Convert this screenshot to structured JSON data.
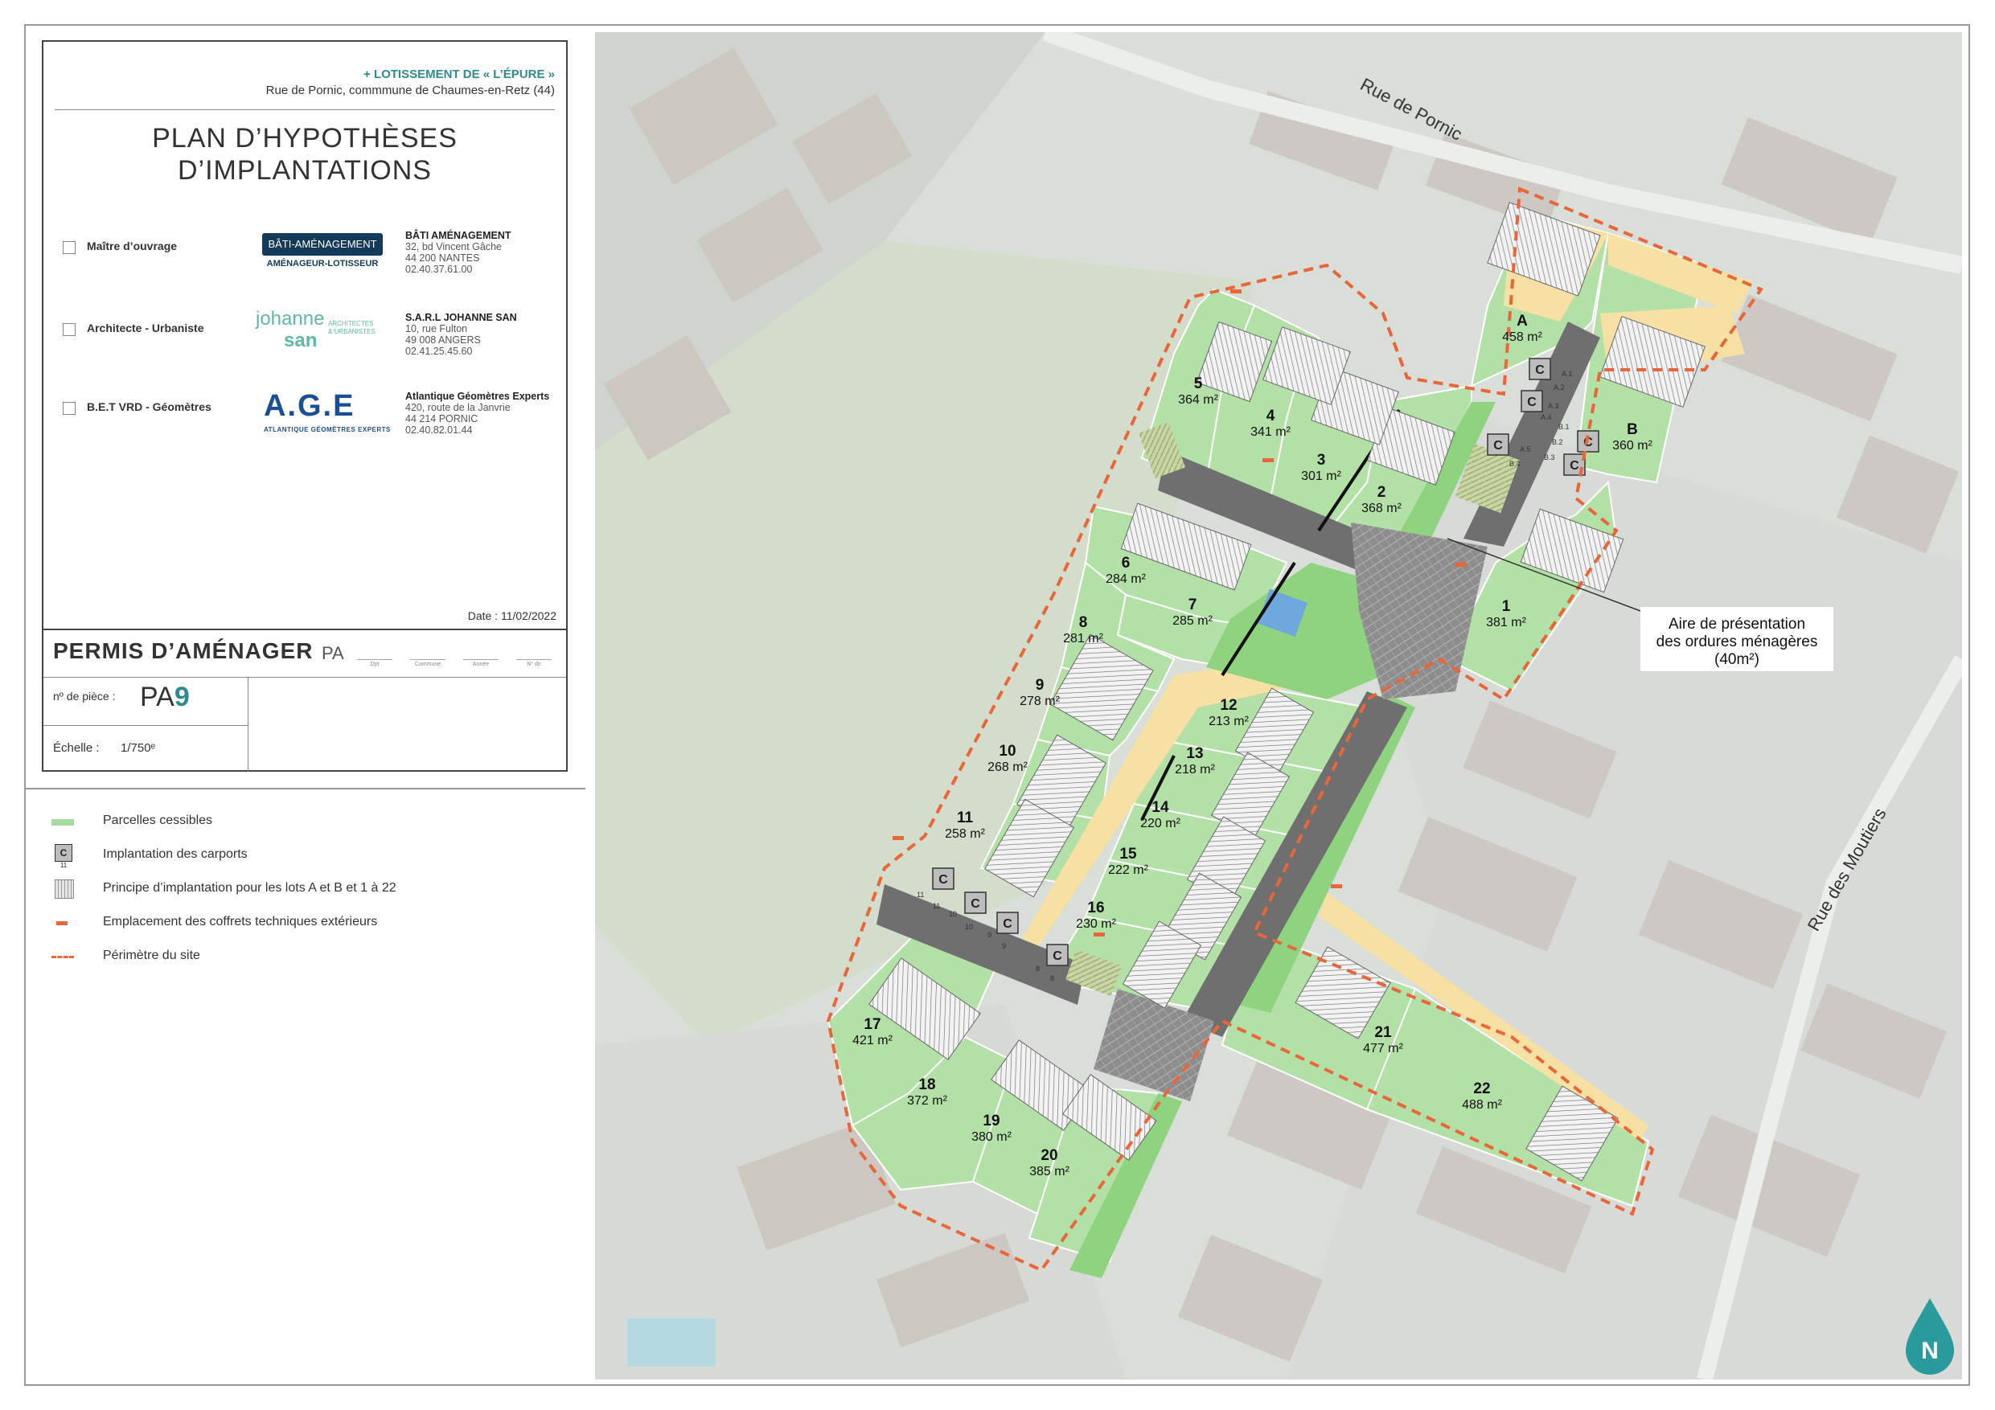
{
  "cartouche": {
    "project_name": "+ LOTISSEMENT DE « L’ÉPURE »",
    "project_address": "Rue de Pornic, commmune de Chaumes-en-Retz (44)",
    "title_line1": "PLAN D’HYPOTHÈSES",
    "title_line2": "D’IMPLANTATIONS",
    "actors": [
      {
        "role": "Maître d’ouvrage",
        "logo_text": "BÂTI-AMÉNAGEMENT",
        "logo_sub": "AMÉNAGEUR-LOTISSEUR",
        "name": "BÂTI AMÉNAGEMENT",
        "addr1": "32, bd Vincent Gâche",
        "addr2": "44 200 NANTES",
        "phone": "02.40.37.61.00"
      },
      {
        "role": "Architecte - Urbaniste",
        "logo_text": "johanne",
        "logo_text2": "san",
        "logo_sub": "ARCHITECTES & URBANISTES",
        "name": "S.A.R.L JOHANNE SAN",
        "addr1": "10, rue Fulton",
        "addr2": "49 008 ANGERS",
        "phone": "02.41.25.45.60"
      },
      {
        "role": "B.E.T VRD - Géomètres",
        "logo_text": "A.G.E",
        "logo_sub": "ATLANTIQUE GÉOMÈTRES EXPERTS",
        "name": "Atlantique Géomètres Experts",
        "addr1": "420, route de la Janvrie",
        "addr2": "44 214 PORNIC",
        "phone": "02.40.82.01.44"
      }
    ],
    "date": "Date : 11/02/2022",
    "permis": "PERMIS D’AMÉNAGER",
    "permis_pa": "PA",
    "codes": [
      "Dpt",
      "Commune",
      "Année",
      "N° dir"
    ],
    "piece_label": "nº de pièce :",
    "piece_prefix": "PA",
    "piece_number": "9",
    "echelle_label": "Échelle :",
    "echelle_value": "1/750ᵉ"
  },
  "legend": [
    {
      "label": "Parcelles cessibles",
      "symbol": "green-bar",
      "color": "#a9dba0"
    },
    {
      "label": "Implantation des carports",
      "symbol": "carport-box",
      "color": "#bdbdbd",
      "box_letter": "C",
      "box_number": "11"
    },
    {
      "label": "Principe d’implantation pour les lots A et B et 1 à 22",
      "symbol": "hatch-box",
      "color": "#cccccc"
    },
    {
      "label": "Emplacement des coffrets techniques extérieurs",
      "symbol": "orange-dash",
      "color": "#e8663a"
    },
    {
      "label": "Périmètre du site",
      "symbol": "dashed-line",
      "color": "#e8663a"
    }
  ],
  "map": {
    "colors": {
      "lot": "#b3e0a6",
      "road": "#6f6f6f",
      "path": "#f7e0a4",
      "green": "#8fd27f",
      "perimeter": "#e8663a",
      "north": "#2a9a9c"
    },
    "streets": [
      "Rue de Pornic",
      "Rue des Moutiers"
    ],
    "annotation": [
      "Aire de présentation",
      "des ordures ménagères",
      "(40m²)"
    ],
    "north_label": "N",
    "carport_letter": "C",
    "carport_labels": [
      "A.1",
      "A.2",
      "A.3",
      "A.4",
      "A.5",
      "B.1",
      "B.2",
      "B.3",
      "B.4",
      "11",
      "11",
      "10",
      "10",
      "9",
      "9",
      "8",
      "8"
    ],
    "lots": [
      {
        "id": "A",
        "area": "458 m²"
      },
      {
        "id": "B",
        "area": "360 m²"
      },
      {
        "id": "1",
        "area": "381 m²"
      },
      {
        "id": "2",
        "area": "368 m²"
      },
      {
        "id": "3",
        "area": "301 m²"
      },
      {
        "id": "4",
        "area": "341 m²"
      },
      {
        "id": "5",
        "area": "364 m²"
      },
      {
        "id": "6",
        "area": "284 m²"
      },
      {
        "id": "7",
        "area": "285 m²"
      },
      {
        "id": "8",
        "area": "281 m²"
      },
      {
        "id": "9",
        "area": "278 m²"
      },
      {
        "id": "10",
        "area": "268 m²"
      },
      {
        "id": "11",
        "area": "258 m²"
      },
      {
        "id": "12",
        "area": "213 m²"
      },
      {
        "id": "13",
        "area": "218 m²"
      },
      {
        "id": "14",
        "area": "220 m²"
      },
      {
        "id": "15",
        "area": "222 m²"
      },
      {
        "id": "16",
        "area": "230 m²"
      },
      {
        "id": "17",
        "area": "421 m²"
      },
      {
        "id": "18",
        "area": "372 m²"
      },
      {
        "id": "19",
        "area": "380 m²"
      },
      {
        "id": "20",
        "area": "385 m²"
      },
      {
        "id": "21",
        "area": "477 m²"
      },
      {
        "id": "22",
        "area": "488 m²"
      }
    ]
  }
}
